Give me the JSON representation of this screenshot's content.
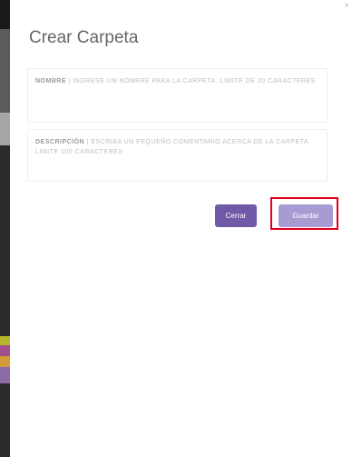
{
  "dialog": {
    "title": "Crear Carpeta",
    "close_label": "×",
    "name_field": {
      "label": "NOMBRE",
      "placeholder": "| INGRESE UN NOMBRE PARA LA CARPETA. LIMITE DE 20 CARACTERES"
    },
    "description_field": {
      "label": "DESCRIPCIÓN",
      "placeholder": "| ESCRIBA UN PEQUEÑO COMENTARIO ACERCA DE LA CARPETA. LIMITE 100 CARACTERES"
    },
    "buttons": {
      "cancel": "Cerrar",
      "save": "Guardar"
    }
  },
  "colors": {
    "primary_button": "#6e5aa6",
    "disabled_button": "#a79bd2",
    "highlight": "#e0001a"
  }
}
